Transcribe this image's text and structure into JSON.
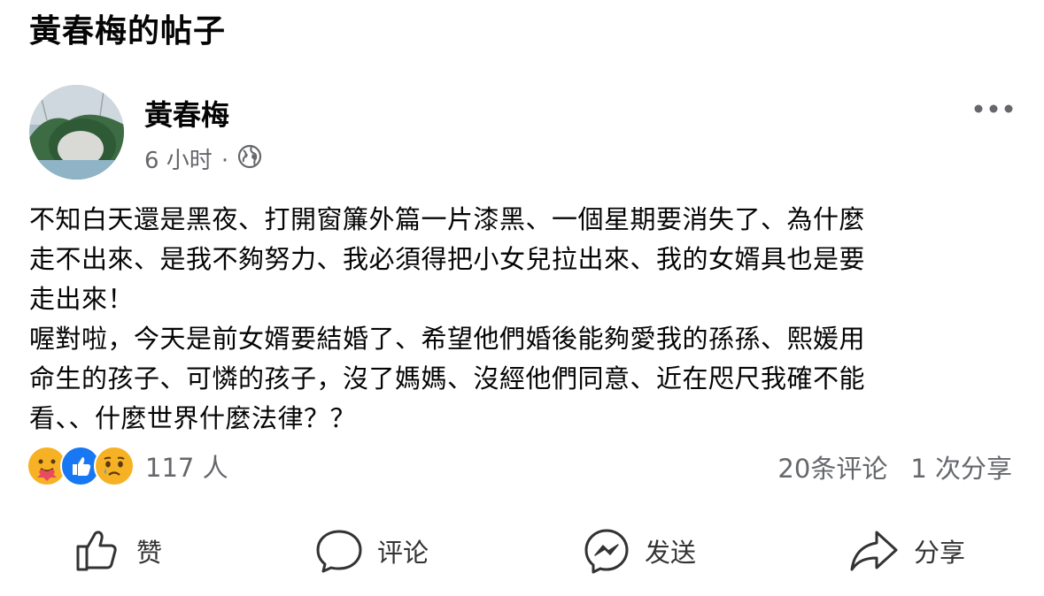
{
  "page": {
    "title": "黃春梅的帖子"
  },
  "post": {
    "author": "黃春梅",
    "time": "6 小时",
    "separator": "·",
    "body": "不知白天還是黑夜、打開窗簾外篇一片漆黑、一個星期要消失了、為什麼\n走不出來、是我不夠努力、我必須得把小女兒拉出來、我的女婿具也是要\n走出來！\n喔對啦，今天是前女婿要結婚了、希望他們婚後能夠愛我的孫孫、熙媛用\n命生的孩子、可憐的孩子，沒了媽媽、沒經他們同意、近在咫尺我確不能\n看、、什麼世界什麼法律？？"
  },
  "reactions": {
    "icons": [
      "care-icon",
      "like-icon",
      "sad-icon"
    ],
    "count": "117 人",
    "comments": "20条评论",
    "shares": "1 次分享"
  },
  "actions": {
    "like": "赞",
    "comment": "评论",
    "send": "发送",
    "share": "分享"
  },
  "colors": {
    "text": "#050505",
    "secondary": "#65676b",
    "like_blue": "#1877f2",
    "emoji_yellow": "#f7b125"
  }
}
